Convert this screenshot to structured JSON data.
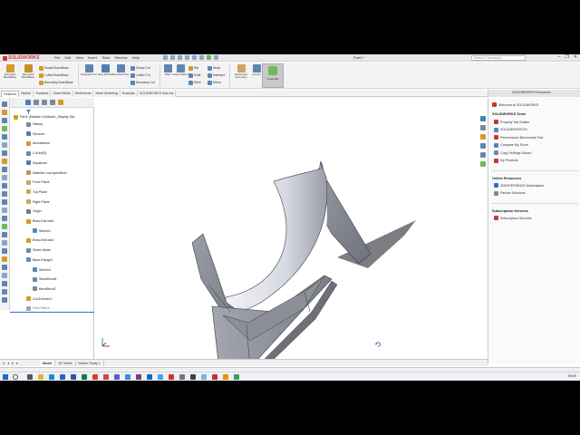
{
  "app": {
    "logo_text": "SOLIDWORKS",
    "document_title": "Part1 *",
    "search_placeholder": "Search Commands",
    "menu": [
      "File",
      "Edit",
      "View",
      "Insert",
      "Tools",
      "Window",
      "Help"
    ]
  },
  "ribbon": {
    "extruded_boss": "Extruded Boss/Base",
    "revolved_boss": "Revolved Boss/Base",
    "swept_boss": "Swept Boss/Base",
    "lofted_boss": "Lofted Boss/Base",
    "boundary_boss": "Boundary Boss/Base",
    "extruded_cut": "Extruded Cut",
    "hole_wizard": "Hole Wizard",
    "revolved_cut": "Revolved Cut",
    "swept_cut": "Swept Cut",
    "lofted_cut": "Lofted Cut",
    "boundary_cut": "Boundary Cut",
    "fillet": "Fillet",
    "linear_pattern": "Linear Pattern",
    "rib": "Rib",
    "draft": "Draft",
    "shell": "Shell",
    "wrap": "Wrap",
    "intersect": "Intersect",
    "mirror": "Mirror",
    "reference_geometry": "Reference Geometry",
    "curves": "Curves",
    "instant3d": "Instant3D"
  },
  "tabs": [
    "Features",
    "Sketch",
    "Surfaces",
    "Sheet Metal",
    "Weldments",
    "Mesh Modeling",
    "Evaluate",
    "SOLIDWORKS Add-Ins"
  ],
  "tree": {
    "root": "Part1 (Default<<Default>_Display Sta",
    "items": [
      {
        "label": "History",
        "color": "#7d8a99"
      },
      {
        "label": "Sensors",
        "color": "#4e7fb3"
      },
      {
        "label": "Annotations",
        "color": "#d49a2a"
      },
      {
        "label": "Cut list(3)",
        "color": "#6b89a8"
      },
      {
        "label": "Equations",
        "color": "#4e7fb3"
      },
      {
        "label": "Material <not specified>",
        "color": "#b89b5e"
      },
      {
        "label": "Front Plane",
        "color": "#c9a85a"
      },
      {
        "label": "Top Plane",
        "color": "#c9a85a"
      },
      {
        "label": "Right Plane",
        "color": "#c9a85a"
      },
      {
        "label": "Origin",
        "color": "#6c7c8c"
      },
      {
        "label": "Boss-Extrude1",
        "color": "#d49a2a"
      },
      {
        "label": "Sketch1",
        "color": "#5d85b0"
      },
      {
        "label": "Boss-Extrude2",
        "color": "#d49a2a"
      },
      {
        "label": "Sheet-Metal",
        "color": "#6b89a8"
      },
      {
        "label": "Base-Flange1",
        "color": "#6b89a8"
      },
      {
        "label": "Sketch3",
        "color": "#5d85b0"
      },
      {
        "label": "SheetBend1",
        "color": "#6b89a8"
      },
      {
        "label": "BendBend1",
        "color": "#6b89a8"
      },
      {
        "label": "Cut-Extrude1",
        "color": "#d49a2a"
      },
      {
        "label": "Flat-Pattern",
        "color": "#9aa7b5"
      }
    ]
  },
  "model_tabs": [
    "Model",
    "3D Views",
    "Motion Study 1"
  ],
  "task_pane": {
    "title": "SOLIDWORKS Resources",
    "welcome": "Welcome to SOLIDWORKS",
    "tools_header": "SOLIDWORKS Tools",
    "tools": [
      "Property Tab Builder",
      "SOLIDWORKS Rx",
      "Performance Benchmark Test",
      "Compare My Score",
      "Copy Settings Wizard",
      "My Products"
    ],
    "online_header": "Online Resources",
    "online": [
      "3DEXPERIENCE Marketplace",
      "Partner Solutions"
    ],
    "subscription_header": "Subscription Services",
    "subscription": [
      "Subscription Services"
    ]
  },
  "status": {
    "clock": "09:59"
  }
}
